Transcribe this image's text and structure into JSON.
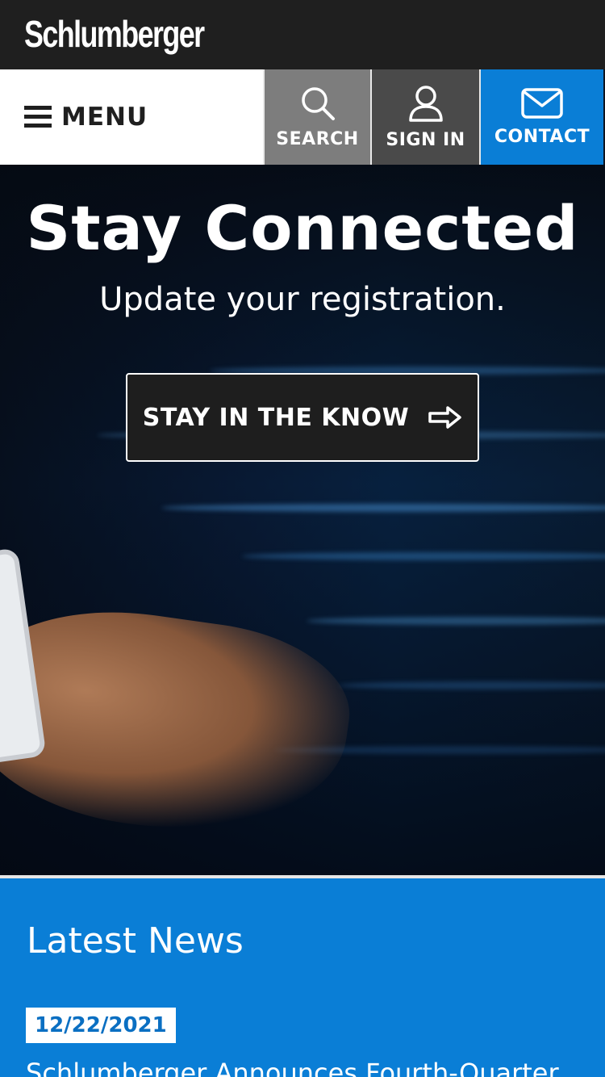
{
  "brand": {
    "logo_text": "Schlumberger"
  },
  "nav": {
    "menu_label": "MENU",
    "search_label": "SEARCH",
    "signin_label": "SIGN IN",
    "contact_label": "CONTACT"
  },
  "hero": {
    "title": "Stay Connected",
    "subtitle": "Update your registration.",
    "cta_label": "STAY IN THE KNOW"
  },
  "news": {
    "heading": "Latest News",
    "items": [
      {
        "date": "12/22/2021",
        "headline": "Schlumberger Announces Fourth-Quarter"
      }
    ]
  },
  "colors": {
    "topbar": "#1f1f1f",
    "search_tile": "#7d7d7d",
    "signin_tile": "#4a4a4a",
    "accent_blue": "#0a7ed6"
  },
  "icons": {
    "search": "search-icon",
    "signin": "user-icon",
    "contact": "envelope-icon",
    "menu": "hamburger-icon",
    "cta": "arrow-right-icon"
  }
}
